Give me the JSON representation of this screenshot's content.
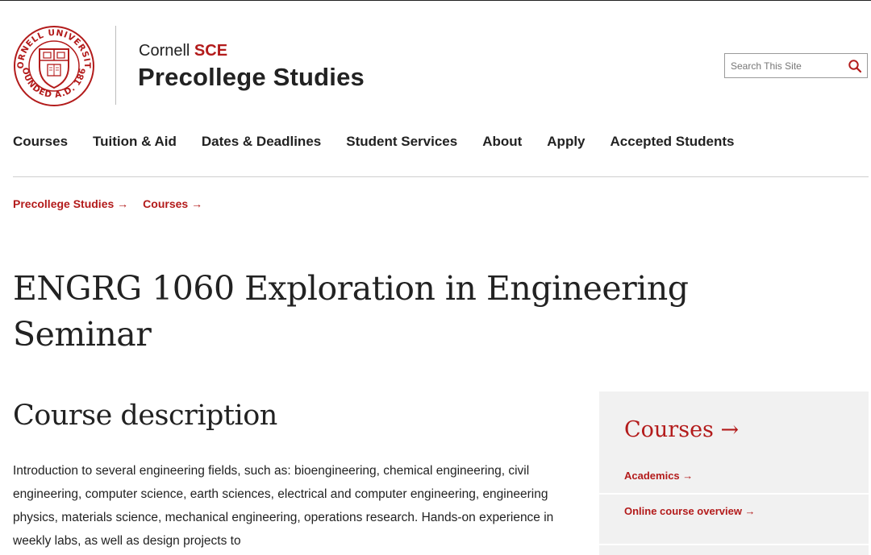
{
  "header": {
    "brand_prefix": "Cornell",
    "brand_accent": "SCE",
    "brand_title": "Precollege Studies",
    "seal": {
      "text_top": "CORNELL UNIVERSITY",
      "text_bottom": "FOUNDED A.D. 1865"
    },
    "search": {
      "placeholder": "Search This Site"
    }
  },
  "nav": {
    "items": [
      {
        "label": "Courses"
      },
      {
        "label": "Tuition & Aid"
      },
      {
        "label": "Dates & Deadlines"
      },
      {
        "label": "Student Services"
      },
      {
        "label": "About"
      },
      {
        "label": "Apply"
      },
      {
        "label": "Accepted Students"
      }
    ]
  },
  "breadcrumb": [
    {
      "label": "Precollege Studies →"
    },
    {
      "label": "Courses →"
    }
  ],
  "main": {
    "page_title": "ENGRG 1060 Exploration in Engineering Seminar",
    "section_title": "Course description",
    "description": "Introduction to several engineering fields, such as: bioengineering, chemical engineering, civil engineering, computer science, earth sciences, electrical and computer engineering, engineering physics, materials science, mechanical engineering, operations research. Hands-on experience in weekly labs, as well as design projects to"
  },
  "sidebar": {
    "title": "Courses →",
    "links": [
      {
        "label": "Academics →"
      },
      {
        "label": "Online course overview →"
      }
    ]
  },
  "colors": {
    "accent": "#b31b1b",
    "text": "#222222",
    "sidebar_bg": "#f1f1f1"
  },
  "icons": {
    "search": "search-icon",
    "seal": "cornell-seal-icon"
  }
}
